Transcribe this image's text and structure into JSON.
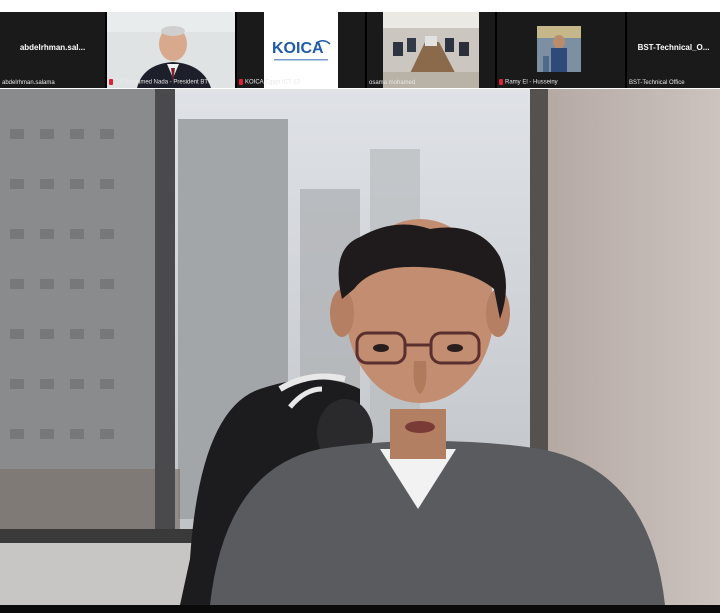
{
  "participants": [
    {
      "name": "abdelrhman.sal...",
      "caption": "abdelrhman.salama"
    },
    {
      "caption": "DR.Mohamed Nada - President BTU"
    },
    {
      "caption": "KOICA Egypt ICT 13",
      "logo": "KOICA"
    },
    {
      "caption": "osama mohamed"
    },
    {
      "caption": "Ramy El - Husseiny"
    },
    {
      "name": "BST-Technical_O...",
      "caption": "BST-Technical Office"
    }
  ],
  "colors": {
    "strip_bg": "#000000",
    "tile_bg": "#1a1a1a",
    "mic_muted": "#dd2233",
    "koica_blue": "#1e5aa8"
  }
}
